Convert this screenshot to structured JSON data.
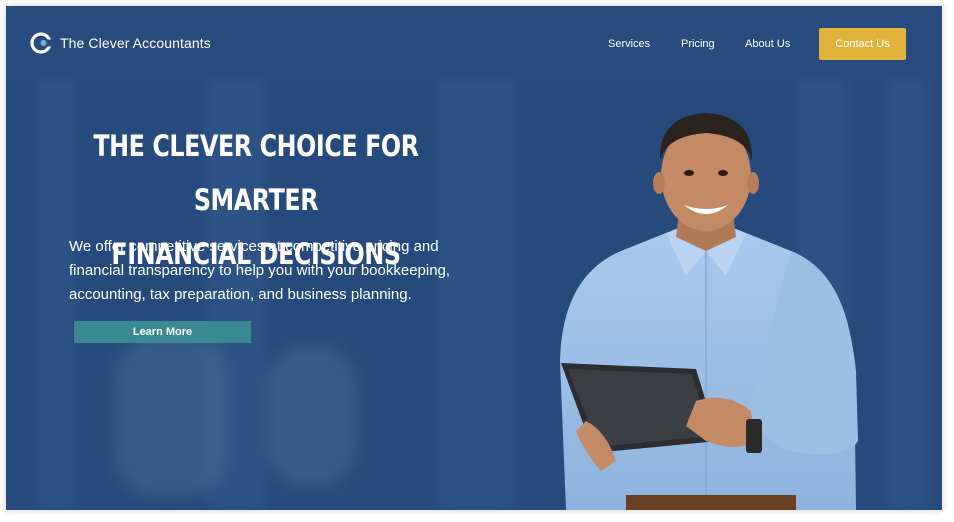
{
  "brand": {
    "name": "The Clever Accountants",
    "logo_icon": "clever-c-logo-icon"
  },
  "nav": {
    "links": [
      {
        "label": "Services"
      },
      {
        "label": "Pricing"
      },
      {
        "label": "About Us"
      }
    ],
    "cta_label": "Contact Us"
  },
  "hero": {
    "title_line1": "THE CLEVER CHOICE FOR SMARTER",
    "title_line2": "FINANCIAL DECISIONS",
    "description": "We offer competitive services at competitive pricing and financial transparency to help you with your bookkeeping, accounting, tax preparation, and business planning.",
    "button_label": "Learn More",
    "image": "smiling-man-holding-tablet"
  },
  "colors": {
    "background": "#264a7c",
    "accent": "#e2b33c",
    "button": "#3a8891"
  }
}
